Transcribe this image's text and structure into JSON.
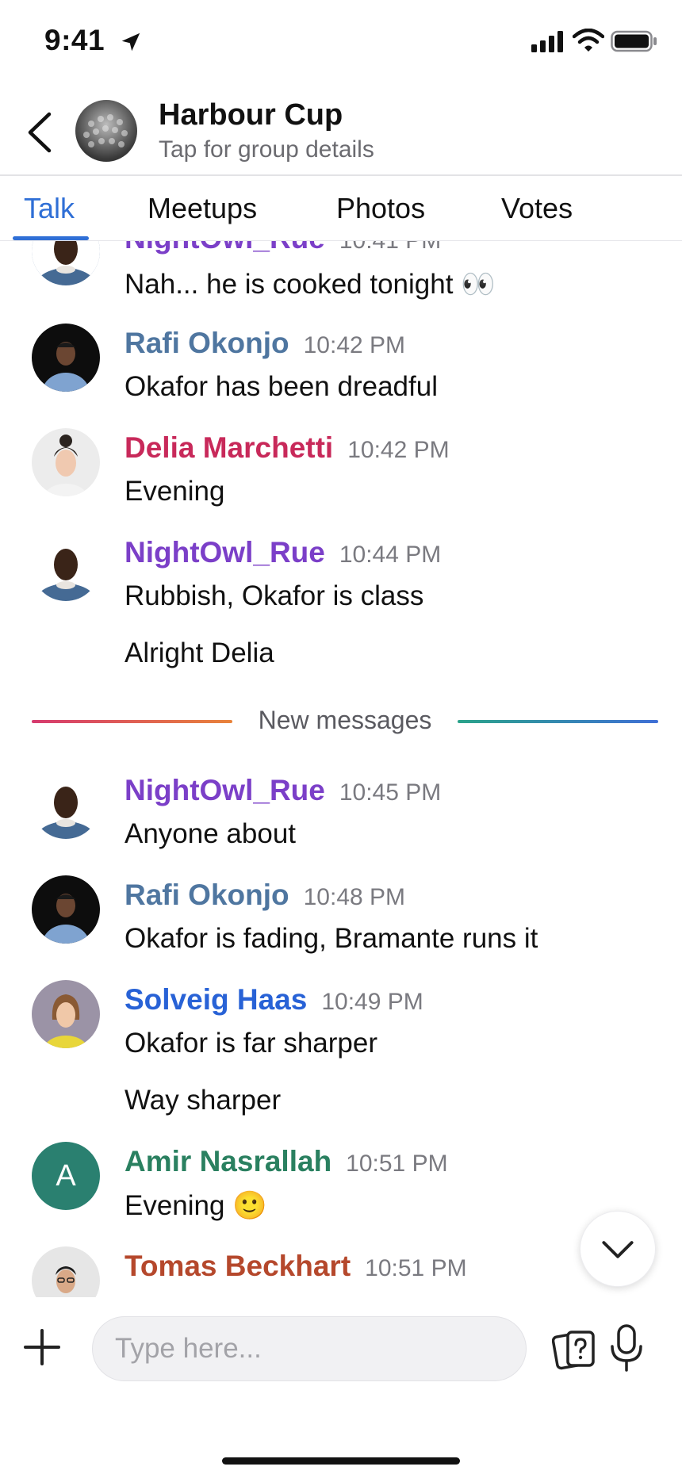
{
  "status_bar": {
    "time": "9:41"
  },
  "header": {
    "title": "Harbour Cup",
    "subtitle": "Tap for group details"
  },
  "tabs": [
    {
      "label": "Talk",
      "active": true
    },
    {
      "label": "Meetups",
      "active": false
    },
    {
      "label": "Photos",
      "active": false
    },
    {
      "label": "Votes",
      "active": false
    }
  ],
  "messages": [
    {
      "author": "NightOwl_Rue",
      "time": "10:41 PM",
      "lines": [
        "Nah... he is cooked tonight 👀"
      ],
      "color": "#7b3fc8",
      "avatar": "photo"
    },
    {
      "author": "Rafi Okonjo",
      "time": "10:42 PM",
      "lines": [
        "Okafor has been dreadful"
      ],
      "color": "#4f76a0",
      "avatar": "photo"
    },
    {
      "author": "Delia Marchetti",
      "time": "10:42 PM",
      "lines": [
        "Evening"
      ],
      "color": "#c8295a",
      "avatar": "photo"
    },
    {
      "author": "NightOwl_Rue",
      "time": "10:44 PM",
      "lines": [
        "Rubbish, Okafor is class",
        "Alright Delia"
      ],
      "color": "#7b3fc8",
      "avatar": "photo"
    },
    {
      "author": "NightOwl_Rue",
      "time": "10:45 PM",
      "lines": [
        "Anyone about"
      ],
      "color": "#7b3fc8",
      "avatar": "photo"
    },
    {
      "author": "Rafi Okonjo",
      "time": "10:48 PM",
      "lines": [
        "Okafor is fading, Bramante runs it"
      ],
      "color": "#4f76a0",
      "avatar": "photo"
    },
    {
      "author": "Solveig Haas",
      "time": "10:49 PM",
      "lines": [
        "Okafor is far sharper",
        "Way sharper"
      ],
      "color": "#2862d6",
      "avatar": "photo"
    },
    {
      "author": "Amir Nasrallah",
      "time": "10:51 PM",
      "lines": [
        "Evening 🙂"
      ],
      "color": "#2a8060",
      "avatar": "A"
    },
    {
      "author": "Tomas Beckhart",
      "time": "10:51 PM",
      "lines": [],
      "color": "#b5482c",
      "avatar": "photo"
    }
  ],
  "divider": {
    "label": "New messages"
  },
  "composer": {
    "placeholder": "Type here..."
  },
  "icons": {
    "back": "chevron-left-icon",
    "add": "plus-icon",
    "quiz": "question-card-icon",
    "mic": "microphone-icon",
    "scroll": "chevron-down-icon"
  }
}
